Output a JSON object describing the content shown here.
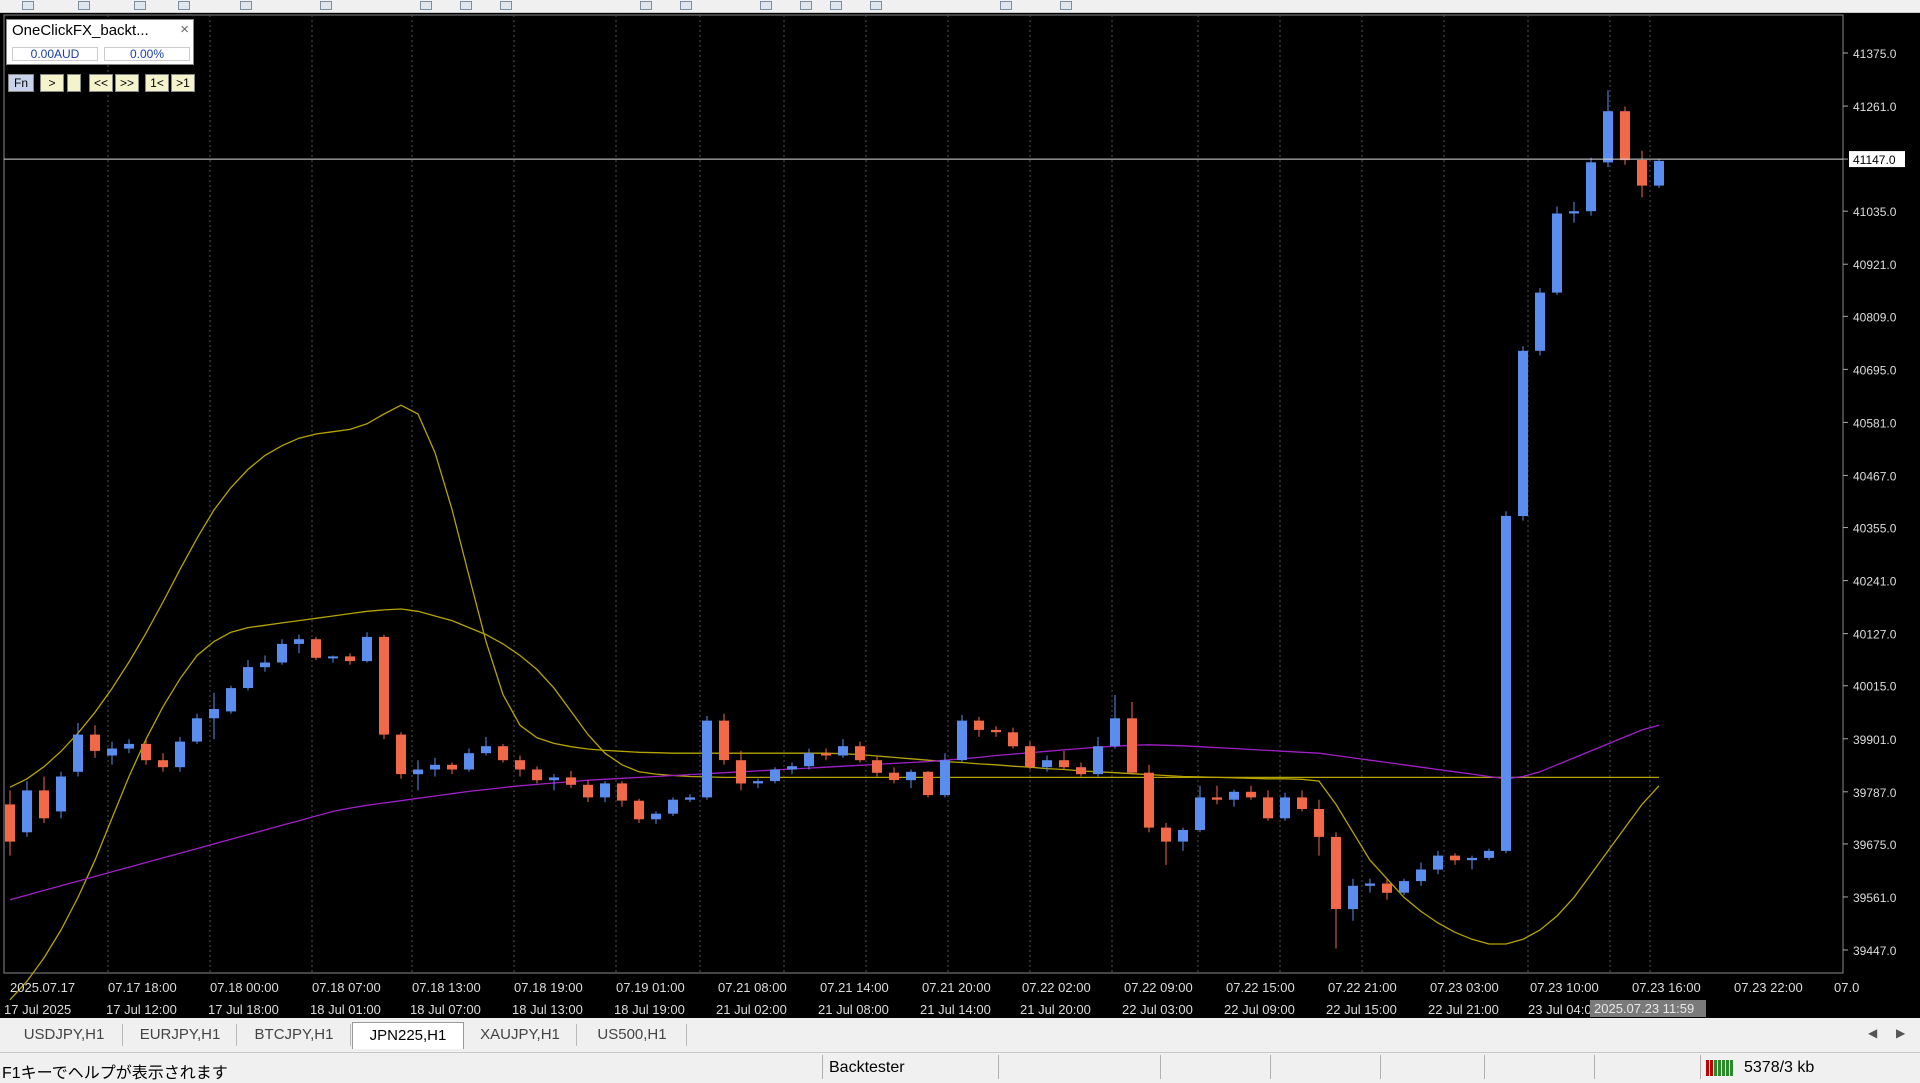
{
  "panel": {
    "title": "OneClickFX_backt...",
    "close": "×",
    "balance": "0.00AUD",
    "percent": "0.00%",
    "buttons": [
      "Fn",
      ">",
      "",
      "<<",
      ">>",
      "1<",
      ">1"
    ]
  },
  "chart": {
    "symbol": "JPN225,H1",
    "current_price": "41147.0",
    "cursor_time": "2025.07.23 11:59",
    "price_labels": [
      "41375.0",
      "41261.0",
      "41147.0",
      "41035.0",
      "40921.0",
      "40809.0",
      "40695.0",
      "40581.0",
      "40467.0",
      "40355.0",
      "40241.0",
      "40127.0",
      "40015.0",
      "39901.0",
      "39787.0",
      "39675.0",
      "39561.0",
      "39447.0"
    ],
    "price_values": [
      41375.0,
      41261.0,
      41147.0,
      41035.0,
      40921.0,
      40809.0,
      40695.0,
      40581.0,
      40467.0,
      40355.0,
      40241.0,
      40127.0,
      40015.0,
      39901.0,
      39787.0,
      39675.0,
      39561.0,
      39447.0
    ],
    "time_labels_top": [
      "2025.07.17",
      "07.17 18:00",
      "07.18 00:00",
      "07.18 07:00",
      "07.18 13:00",
      "07.18 19:00",
      "07.19 01:00",
      "07.21 08:00",
      "07.21 14:00",
      "07.21 20:00",
      "07.22 02:00",
      "07.22 09:00",
      "07.22 15:00",
      "07.22 21:00",
      "07.23 03:00",
      "07.23 10:00",
      "07.23 16:00",
      "07.23 22:00",
      "07.0"
    ],
    "time_labels_bottom": [
      "17 Jul 2025",
      "17 Jul 12:00",
      "17 Jul 18:00",
      "18 Jul 01:00",
      "18 Jul 07:00",
      "18 Jul 13:00",
      "18 Jul 19:00",
      "21 Jul 02:00",
      "21 Jul 08:00",
      "21 Jul 14:00",
      "21 Jul 20:00",
      "22 Jul 03:00",
      "22 Jul 09:00",
      "22 Jul 15:00",
      "22 Jul 21:00",
      "23 Jul 04:00"
    ],
    "colors": {
      "bull": "#5b8def",
      "bear": "#f2694a",
      "band": "#b5a400",
      "ma": "#a020c8",
      "grid": "#4a4a4a"
    },
    "candles": [
      [
        39760,
        39790,
        39650,
        39680
      ],
      [
        39700,
        39810,
        39690,
        39790
      ],
      [
        39790,
        39820,
        39720,
        39730
      ],
      [
        39745,
        39830,
        39730,
        39820
      ],
      [
        39830,
        39935,
        39820,
        39910
      ],
      [
        39910,
        39930,
        39860,
        39875
      ],
      [
        39865,
        39895,
        39845,
        39880
      ],
      [
        39880,
        39900,
        39870,
        39890
      ],
      [
        39890,
        39900,
        39845,
        39855
      ],
      [
        39855,
        39870,
        39830,
        39840
      ],
      [
        39840,
        39905,
        39830,
        39895
      ],
      [
        39895,
        39955,
        39890,
        39945
      ],
      [
        39945,
        40000,
        39900,
        39965
      ],
      [
        39960,
        40015,
        39955,
        40010
      ],
      [
        40010,
        40070,
        40005,
        40055
      ],
      [
        40055,
        40080,
        40045,
        40065
      ],
      [
        40065,
        40115,
        40060,
        40105
      ],
      [
        40105,
        40125,
        40085,
        40115
      ],
      [
        40115,
        40120,
        40070,
        40075
      ],
      [
        40075,
        40080,
        40065,
        40078
      ],
      [
        40078,
        40085,
        40060,
        40068
      ],
      [
        40068,
        40130,
        40065,
        40120
      ],
      [
        40120,
        40125,
        39900,
        39910
      ],
      [
        39910,
        39915,
        39815,
        39825
      ],
      [
        39825,
        39855,
        39790,
        39835
      ],
      [
        39835,
        39860,
        39820,
        39845
      ],
      [
        39845,
        39850,
        39825,
        39835
      ],
      [
        39835,
        39880,
        39830,
        39870
      ],
      [
        39870,
        39905,
        39865,
        39885
      ],
      [
        39885,
        39890,
        39850,
        39855
      ],
      [
        39855,
        39865,
        39820,
        39835
      ],
      [
        39835,
        39842,
        39805,
        39812
      ],
      [
        39812,
        39825,
        39790,
        39818
      ],
      [
        39818,
        39832,
        39795,
        39802
      ],
      [
        39802,
        39812,
        39765,
        39775
      ],
      [
        39775,
        39810,
        39765,
        39805
      ],
      [
        39805,
        39810,
        39755,
        39768
      ],
      [
        39768,
        39772,
        39720,
        39728
      ],
      [
        39728,
        39745,
        39718,
        39740
      ],
      [
        39740,
        39775,
        39735,
        39770
      ],
      [
        39770,
        39782,
        39765,
        39775
      ],
      [
        39775,
        39950,
        39770,
        39940
      ],
      [
        39940,
        39955,
        39845,
        39855
      ],
      [
        39855,
        39875,
        39790,
        39805
      ],
      [
        39805,
        39815,
        39795,
        39810
      ],
      [
        39810,
        39840,
        39805,
        39835
      ],
      [
        39835,
        39850,
        39825,
        39842
      ],
      [
        39842,
        39880,
        39835,
        39870
      ],
      [
        39870,
        39880,
        39855,
        39865
      ],
      [
        39865,
        39900,
        39860,
        39885
      ],
      [
        39885,
        39895,
        39850,
        39855
      ],
      [
        39855,
        39865,
        39820,
        39828
      ],
      [
        39828,
        39840,
        39805,
        39812
      ],
      [
        39812,
        39835,
        39795,
        39830
      ],
      [
        39830,
        39832,
        39775,
        39780
      ],
      [
        39780,
        39870,
        39775,
        39855
      ],
      [
        39855,
        39952,
        39850,
        39940
      ],
      [
        39940,
        39948,
        39905,
        39920
      ],
      [
        39920,
        39928,
        39905,
        39915
      ],
      [
        39915,
        39925,
        39880,
        39885
      ],
      [
        39885,
        39895,
        39835,
        39840
      ],
      [
        39840,
        39865,
        39830,
        39855
      ],
      [
        39855,
        39875,
        39835,
        39840
      ],
      [
        39840,
        39850,
        39820,
        39825
      ],
      [
        39825,
        39905,
        39820,
        39885
      ],
      [
        39885,
        39995,
        39880,
        39945
      ],
      [
        39945,
        39980,
        39825,
        39828
      ],
      [
        39828,
        39845,
        39700,
        39710
      ],
      [
        39710,
        39720,
        39630,
        39680
      ],
      [
        39680,
        39710,
        39660,
        39705
      ],
      [
        39705,
        39800,
        39700,
        39775
      ],
      [
        39775,
        39800,
        39760,
        39770
      ],
      [
        39770,
        39792,
        39755,
        39787
      ],
      [
        39787,
        39800,
        39770,
        39775
      ],
      [
        39775,
        39790,
        39725,
        39730
      ],
      [
        39730,
        39785,
        39725,
        39775
      ],
      [
        39775,
        39790,
        39745,
        39750
      ],
      [
        39750,
        39770,
        39650,
        39690
      ],
      [
        39690,
        39700,
        39450,
        39535
      ],
      [
        39535,
        39600,
        39510,
        39585
      ],
      [
        39585,
        39600,
        39570,
        39590
      ],
      [
        39590,
        39600,
        39555,
        39570
      ],
      [
        39570,
        39600,
        39565,
        39595
      ],
      [
        39595,
        39635,
        39585,
        39620
      ],
      [
        39620,
        39660,
        39610,
        39650
      ],
      [
        39650,
        39655,
        39630,
        39640
      ],
      [
        39640,
        39650,
        39620,
        39645
      ],
      [
        39645,
        39665,
        39640,
        39660
      ],
      [
        39660,
        40390,
        39655,
        40380
      ],
      [
        40380,
        40745,
        40370,
        40735
      ],
      [
        40735,
        40870,
        40725,
        40860
      ],
      [
        40860,
        41045,
        40855,
        41030
      ],
      [
        41030,
        41055,
        41010,
        41035
      ],
      [
        41035,
        41150,
        41025,
        41140
      ],
      [
        41140,
        41295,
        41130,
        41250
      ],
      [
        41250,
        41260,
        41135,
        41145
      ],
      [
        41145,
        41165,
        41065,
        41090
      ],
      [
        41090,
        41148,
        41085,
        41143
      ]
    ],
    "moving_average": [
      39555,
      39565,
      39575,
      39585,
      39595,
      39605,
      39615,
      39625,
      39635,
      39645,
      39655,
      39665,
      39675,
      39685,
      39695,
      39705,
      39715,
      39725,
      39735,
      39745,
      39752,
      39758,
      39763,
      39768,
      39773,
      39778,
      39783,
      39788,
      39792,
      39796,
      39800,
      39803,
      39806,
      39809,
      39812,
      39814,
      39816,
      39818,
      39820,
      39822,
      39824,
      39826,
      39828,
      39830,
      39832,
      39834,
      39836,
      39838,
      39840,
      39842,
      39844,
      39846,
      39848,
      39850,
      39852,
      39855,
      39858,
      39861,
      39865,
      39868,
      39871,
      39874,
      39877,
      39880,
      39883,
      39885,
      39887,
      39888,
      39887,
      39886,
      39884,
      39882,
      39880,
      39878,
      39876,
      39874,
      39872,
      39870,
      39865,
      39860,
      39855,
      39850,
      39845,
      39840,
      39835,
      39830,
      39825,
      39820,
      39815,
      39820,
      39830,
      39845,
      39860,
      39875,
      39890,
      39905,
      39920,
      39930
    ],
    "band_upper": [
      39797,
      39815,
      39841,
      39874,
      39913,
      39958,
      40009,
      40066,
      40128,
      40195,
      40265,
      40332,
      40393,
      40441,
      40480,
      40510,
      40531,
      40547,
      40556,
      40561,
      40566,
      40578,
      40599,
      40618,
      40599,
      40516,
      40394,
      40251,
      40110,
      39996,
      39930,
      39903,
      39891,
      39884,
      39879,
      39876,
      39874,
      39872,
      39871,
      39870,
      39870,
      39870,
      39870,
      39870,
      39870,
      39870,
      39870,
      39870,
      39870,
      39869,
      39867,
      39864,
      39861,
      39858,
      39855,
      39852,
      39850,
      39847,
      39845,
      39842,
      39840,
      39837,
      39835,
      39832,
      39830,
      39828,
      39826,
      39824,
      39822,
      39820,
      39819,
      39818,
      39817,
      39816,
      39815,
      39815,
      39814,
      39810,
      39760,
      39700,
      39640,
      39600,
      39560,
      39530,
      39505,
      39485,
      39470,
      39460,
      39460,
      39470,
      39490,
      39520,
      39560,
      39610,
      39660,
      39710,
      39760,
      39800
    ],
    "band_lower": [
      39340,
      39380,
      39430,
      39490,
      39560,
      39640,
      39730,
      39820,
      39900,
      39970,
      40030,
      40080,
      40110,
      40130,
      40140,
      40145,
      40150,
      40155,
      40160,
      40165,
      40170,
      40175,
      40178,
      40180,
      40175,
      40165,
      40155,
      40140,
      40125,
      40105,
      40080,
      40050,
      40010,
      39960,
      39910,
      39870,
      39845,
      39830,
      39825,
      39822,
      39820,
      39819,
      39818,
      39818,
      39818,
      39818,
      39818,
      39818,
      39818,
      39818,
      39818,
      39818,
      39818,
      39818,
      39818,
      39818,
      39818,
      39818,
      39818,
      39818,
      39818,
      39818,
      39818,
      39818,
      39818,
      39818,
      39818,
      39818,
      39818,
      39818,
      39818,
      39818,
      39818,
      39818,
      39818,
      39818,
      39818,
      39818,
      39818,
      39818,
      39818,
      39818,
      39818,
      39818,
      39818,
      39818,
      39818,
      39818,
      39818,
      39818,
      39818,
      39818,
      39818,
      39818,
      39818,
      39818,
      39818,
      39818
    ]
  },
  "tabs": [
    "USDJPY,H1",
    "EURJPY,H1",
    "BTCJPY,H1",
    "JPN225,H1",
    "XAUJPY,H1",
    "US500,H1"
  ],
  "active_tab": "JPN225,H1",
  "tab_arrows": [
    "◀",
    "▶"
  ],
  "status": {
    "help": "F1キーでヘルプが表示されます",
    "profile": "Backtester",
    "traffic": "5378/3 kb"
  }
}
